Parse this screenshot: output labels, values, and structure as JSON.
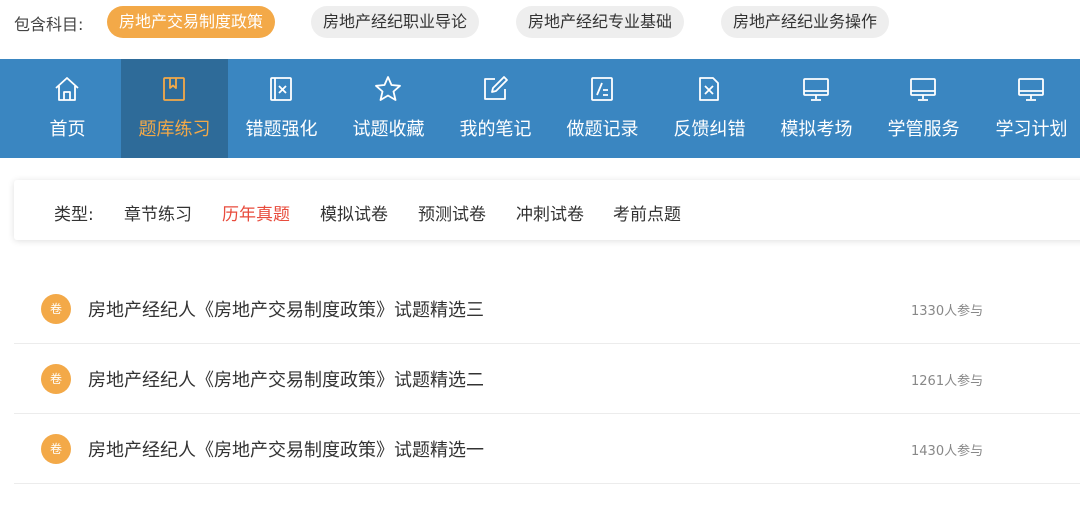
{
  "subjects": {
    "label": "包含科目:",
    "items": [
      {
        "label": "房地产交易制度政策",
        "active": true
      },
      {
        "label": "房地产经纪职业导论",
        "active": false
      },
      {
        "label": "房地产经纪专业基础",
        "active": false
      },
      {
        "label": "房地产经纪业务操作",
        "active": false
      }
    ]
  },
  "nav": {
    "items": [
      {
        "label": "首页",
        "icon": "home-icon"
      },
      {
        "label": "题库练习",
        "icon": "book-icon",
        "active": true
      },
      {
        "label": "错题强化",
        "icon": "error-book-icon"
      },
      {
        "label": "试题收藏",
        "icon": "star-icon"
      },
      {
        "label": "我的笔记",
        "icon": "edit-note-icon"
      },
      {
        "label": "做题记录",
        "icon": "record-icon"
      },
      {
        "label": "反馈纠错",
        "icon": "feedback-icon"
      },
      {
        "label": "模拟考场",
        "icon": "monitor-icon"
      },
      {
        "label": "学管服务",
        "icon": "monitor-icon"
      },
      {
        "label": "学习计划",
        "icon": "monitor-icon"
      }
    ]
  },
  "types": {
    "label": "类型:",
    "items": [
      {
        "label": "章节练习",
        "active": false
      },
      {
        "label": "历年真题",
        "active": true
      },
      {
        "label": "模拟试卷",
        "active": false
      },
      {
        "label": "预测试卷",
        "active": false
      },
      {
        "label": "冲刺试卷",
        "active": false
      },
      {
        "label": "考前点题",
        "active": false
      }
    ]
  },
  "papers": [
    {
      "badge": "卷",
      "title": "房地产经纪人《房地产交易制度政策》试题精选三",
      "count": "1330人参与"
    },
    {
      "badge": "卷",
      "title": "房地产经纪人《房地产交易制度政策》试题精选二",
      "count": "1261人参与"
    },
    {
      "badge": "卷",
      "title": "房地产经纪人《房地产交易制度政策》试题精选一",
      "count": "1430人参与"
    }
  ],
  "colors": {
    "nav_bg": "#3a86c1",
    "nav_active_bg": "#2e6b99",
    "accent": "#f3a948",
    "active_type": "#e84c3d"
  }
}
